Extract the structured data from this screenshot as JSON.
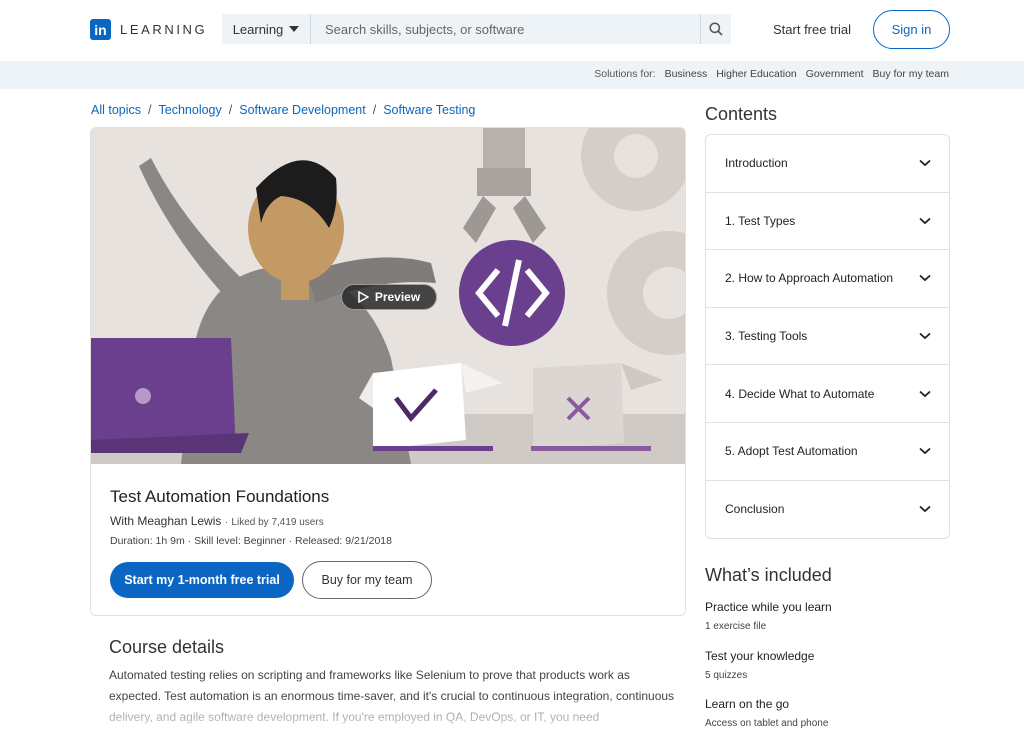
{
  "header": {
    "logo_mark": "in",
    "logo_text": "LEARNING",
    "search_category": "Learning",
    "search_placeholder": "Search skills, subjects, or software",
    "start_trial": "Start free trial",
    "sign_in": "Sign in"
  },
  "subbar": {
    "label": "Solutions for:",
    "links": [
      "Business",
      "Higher Education",
      "Government",
      "Buy for my team"
    ]
  },
  "breadcrumb": [
    "All topics",
    "Technology",
    "Software Development",
    "Software Testing"
  ],
  "breadcrumb_sep": "/",
  "course": {
    "preview_label": "Preview",
    "title": "Test Automation Foundations",
    "author": "With Meaghan Lewis",
    "dot": "·",
    "likes": "Liked by 7,419 users",
    "duration": "Duration: 1h 9m",
    "skill": "Skill level: Beginner",
    "released": "Released: 9/21/2018",
    "cta_primary": "Start my 1-month free trial",
    "cta_secondary": "Buy for my team"
  },
  "details": {
    "title": "Course details",
    "text": "Automated testing relies on scripting and frameworks like Selenium to prove that products work as expected. Test automation is an enormous time-saver, and it's crucial to continuous integration, continuous delivery, and agile software development. If you're employed in QA, DevOps, or IT, you need"
  },
  "contents": {
    "title": "Contents",
    "items": [
      "Introduction",
      "1. Test Types",
      "2. How to Approach Automation",
      "3. Testing Tools",
      "4. Decide What to Automate",
      "5. Adopt Test Automation",
      "Conclusion"
    ]
  },
  "included": {
    "title": "What’s included",
    "items": [
      {
        "head": "Practice while you learn",
        "sub": "1 exercise file"
      },
      {
        "head": "Test your knowledge",
        "sub": "5 quizzes"
      },
      {
        "head": "Learn on the go",
        "sub": "Access on tablet and phone"
      }
    ]
  },
  "colors": {
    "brand": "#0a66c2",
    "purple": "#6a3f8e"
  }
}
